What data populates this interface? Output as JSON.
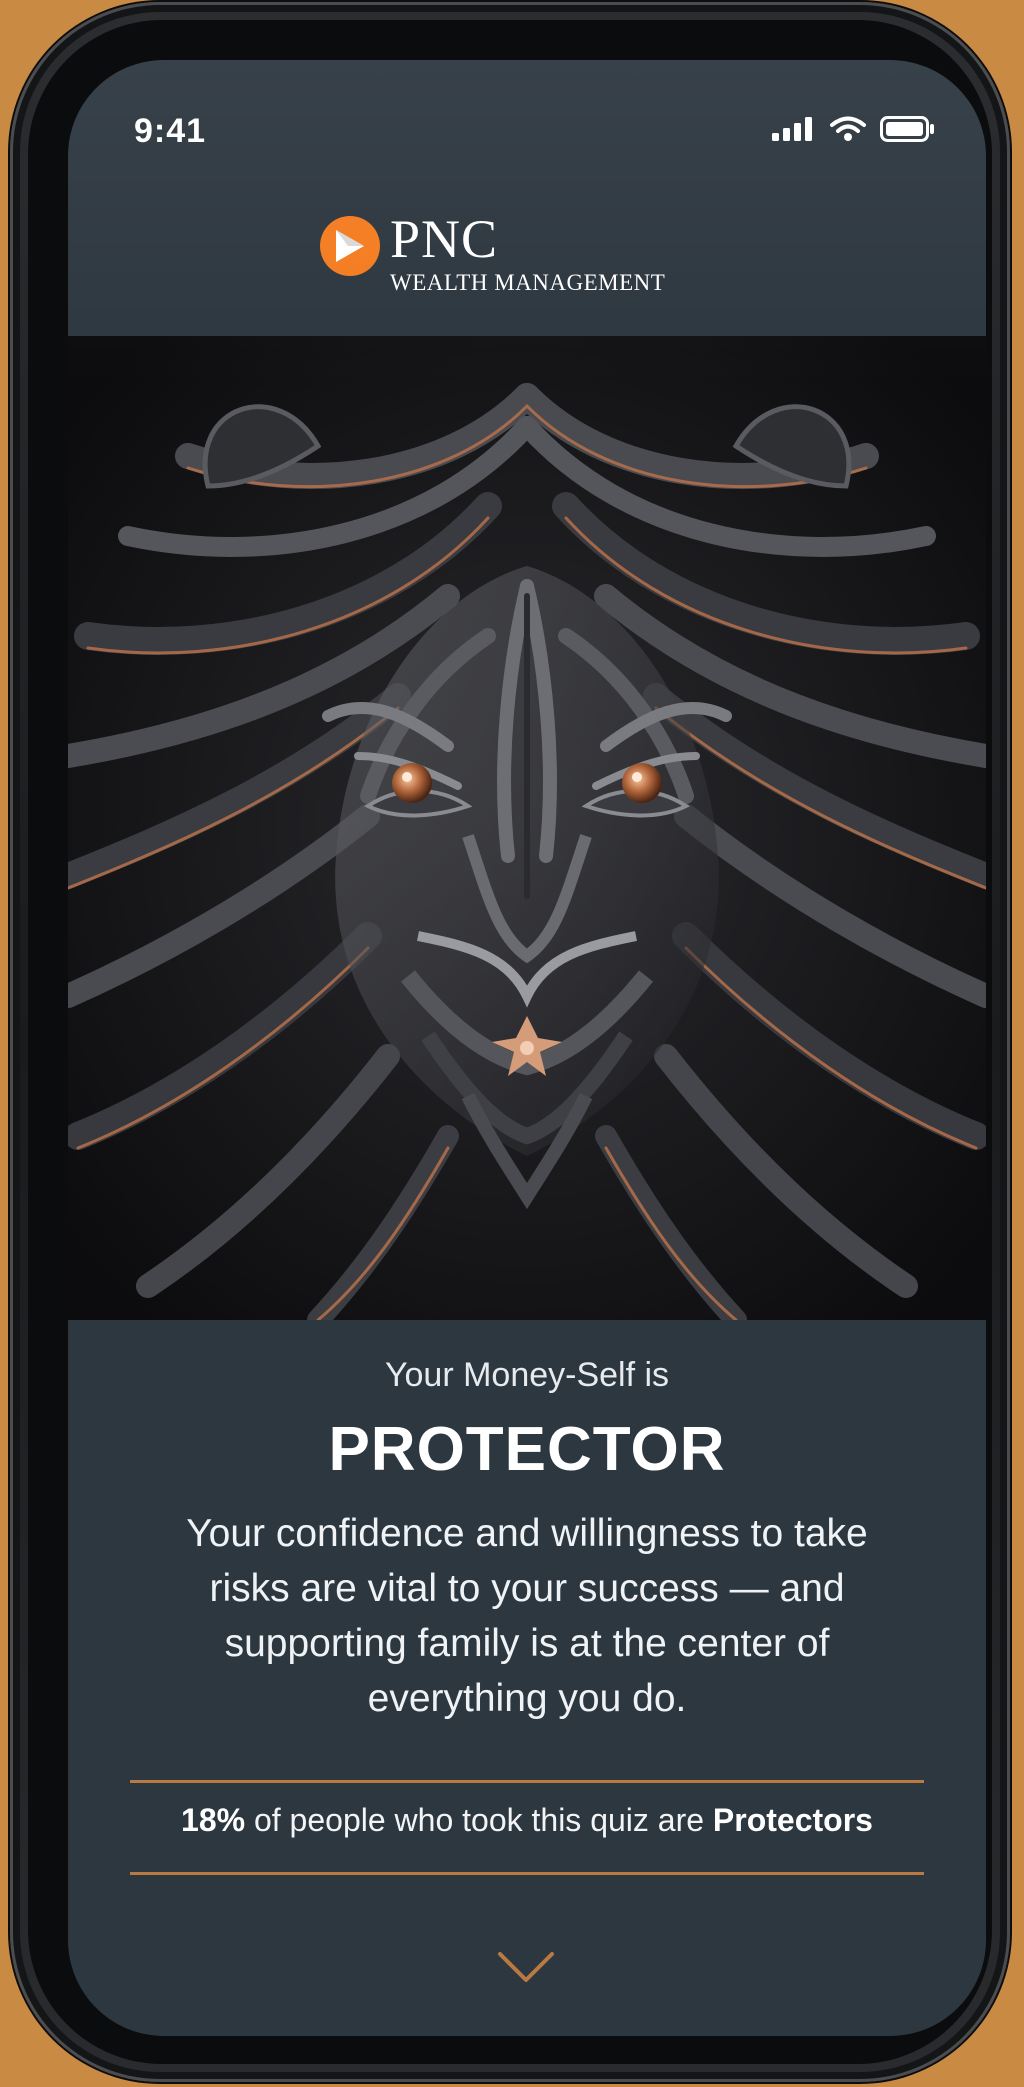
{
  "status_bar": {
    "time": "9:41",
    "icons": [
      "signal-icon",
      "wifi-icon",
      "battery-icon"
    ]
  },
  "brand": {
    "name": "PNC",
    "subtitle": "WEALTH MANAGEMENT",
    "accent_color": "#f47c20"
  },
  "hero": {
    "icon": "lion-illustration"
  },
  "result": {
    "intro": "Your Money-Self is",
    "title": "PROTECTOR",
    "description": "Your confidence and willingness to take risks are vital to your success — and supporting family is at the center of everything you do."
  },
  "stat": {
    "percent": "18%",
    "middle_text": " of people who took this quiz are ",
    "type_label": "Protectors"
  },
  "scroll": {
    "icon": "chevron-down-icon"
  },
  "colors": {
    "background": "#c98a43",
    "screen": "#2d3740",
    "accent_line": "#b87a42"
  }
}
